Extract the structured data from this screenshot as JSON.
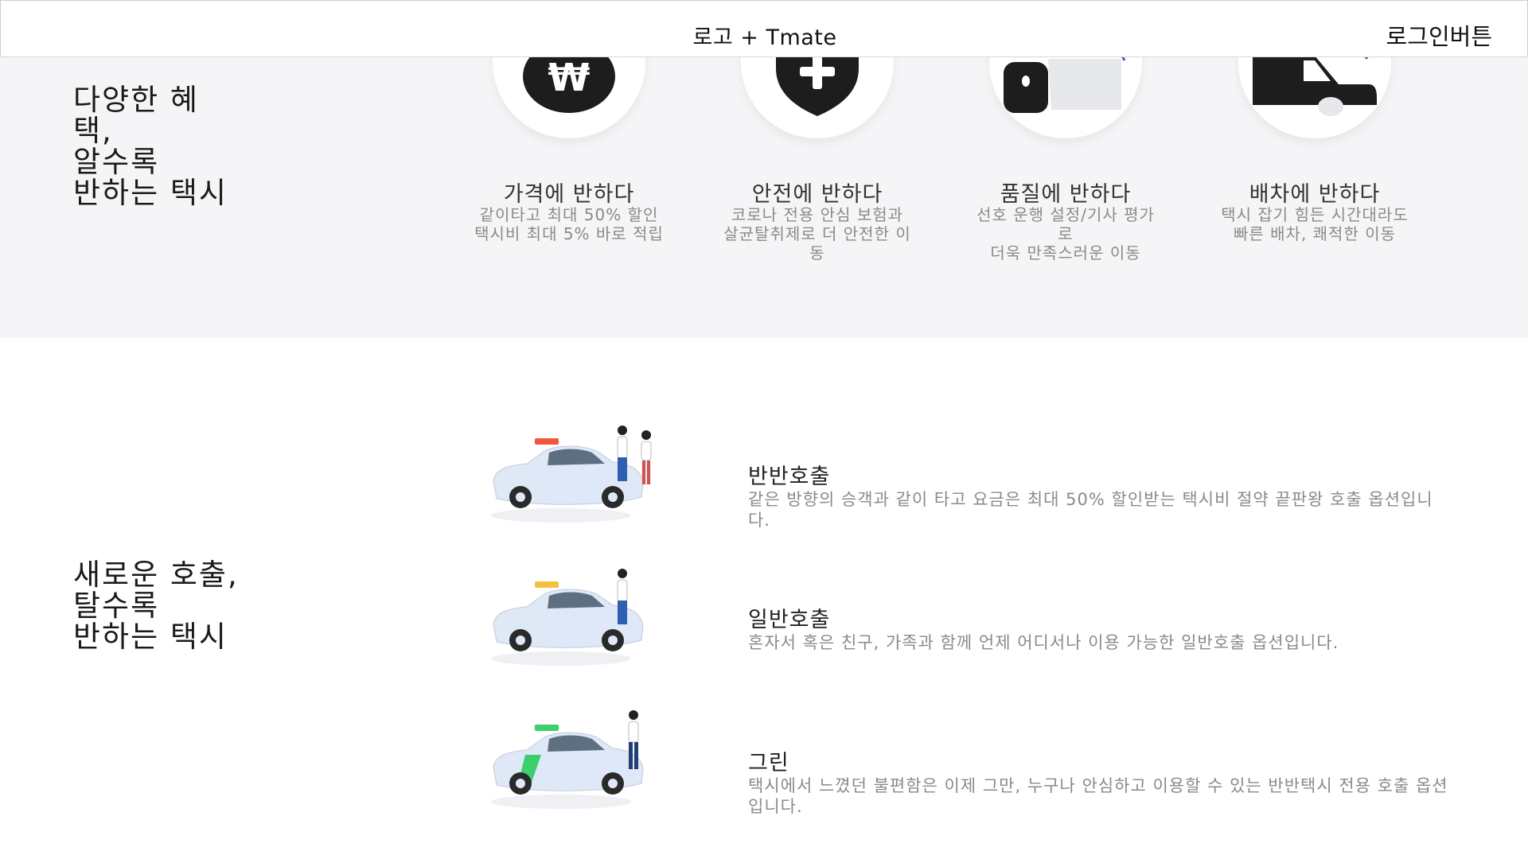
{
  "header": {
    "logo_text": "로고 + Tmate",
    "login_label": "로그인버튼"
  },
  "benefits": {
    "title_lines": [
      "다양한 혜",
      "택,",
      "알수록",
      "반하는 택시"
    ],
    "items": [
      {
        "icon": "won-coin-icon",
        "title": "가격에 반하다",
        "desc_lines": [
          "같이타고 최대 50% 할인",
          "택시비 최대 5% 바로 적립"
        ]
      },
      {
        "icon": "shield-plus-icon",
        "title": "안전에 반하다",
        "desc_lines": [
          "코로나 전용 안심 보험과",
          "살균탈취제로 더 안전한 이",
          "동"
        ]
      },
      {
        "icon": "thumbs-up-icon",
        "title": "품질에 반하다",
        "desc_lines": [
          "선호 운행 설정/기사 평가",
          "로",
          "더욱 만족스러운 이동"
        ]
      },
      {
        "icon": "car-icon",
        "title": "배차에 반하다",
        "desc_lines": [
          "택시 잡기 힘든 시간대라도",
          "빠른 배차, 쾌적한 이동"
        ]
      }
    ]
  },
  "calls": {
    "title_lines": [
      "새로운 호출,",
      "탈수록",
      "반하는 택시"
    ],
    "items": [
      {
        "name": "반반호출",
        "desc": "같은 방향의 승객과 같이 타고 요금은 최대 50% 할인받는 택시비 절약 끝판왕 호출 옵션입니다.",
        "roof_color": "#f2563f",
        "people": 2
      },
      {
        "name": "일반호출",
        "desc": "혼자서 혹은 친구, 가족과 함께 언제 어디서나 이용 가능한 일반호출 옵션입니다.",
        "roof_color": "#f5c33b",
        "people": 1
      },
      {
        "name": "그린",
        "desc": "택시에서 느꼈던 불편함은 이제 그만, 누구나 안심하고 이용할 수 있는 반반택시 전용 호출 옵션입니다.",
        "roof_color": "#3ccf6e",
        "people": 1
      }
    ]
  },
  "colors": {
    "section_bg": "#f5f5f7",
    "muted_text": "#8a8a8a",
    "icon_dark": "#1d1d1d",
    "accent_blue": "#3a63d9"
  }
}
